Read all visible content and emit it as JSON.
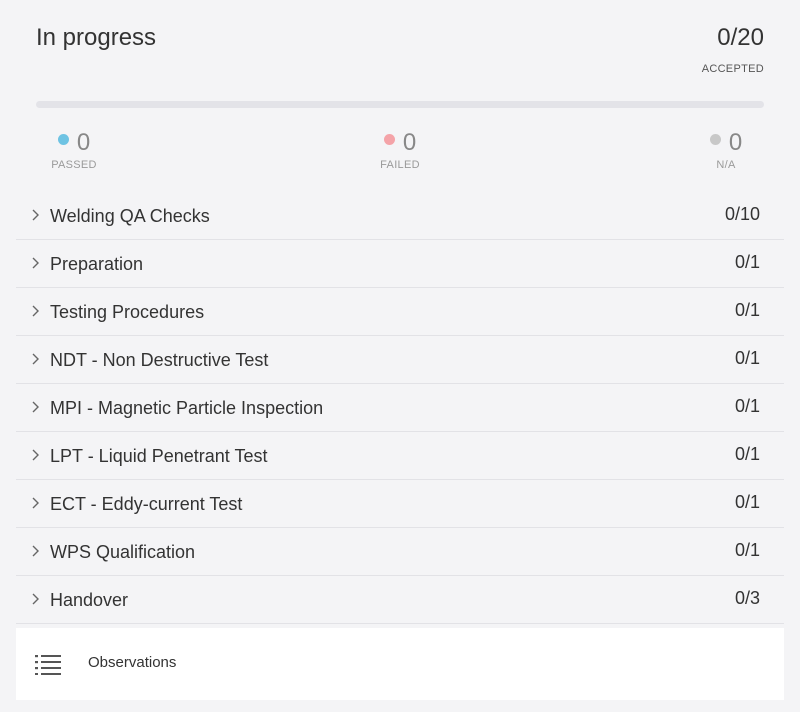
{
  "status": {
    "title": "In progress",
    "accepted_count": "0/20",
    "accepted_label": "ACCEPTED",
    "progress_fraction": 0
  },
  "stats": {
    "passed": {
      "value": "0",
      "label": "PASSED",
      "color": "#6ec3e3"
    },
    "failed": {
      "value": "0",
      "label": "FAILED",
      "color": "#f4a3a8"
    },
    "na": {
      "value": "0",
      "label": "N/A",
      "color": "#c8c8c8"
    }
  },
  "sections": [
    {
      "name": "Welding QA Checks",
      "count": "0/10"
    },
    {
      "name": "Preparation",
      "count": "0/1"
    },
    {
      "name": "Testing Procedures",
      "count": "0/1"
    },
    {
      "name": "NDT - Non Destructive Test",
      "count": "0/1"
    },
    {
      "name": "MPI - Magnetic Particle Inspection",
      "count": "0/1"
    },
    {
      "name": "LPT - Liquid Penetrant Test",
      "count": "0/1"
    },
    {
      "name": "ECT - Eddy-current Test",
      "count": "0/1"
    },
    {
      "name": "WPS Qualification",
      "count": "0/1"
    },
    {
      "name": "Handover",
      "count": "0/3"
    }
  ],
  "observations": {
    "label": "Observations",
    "icon": "list-icon"
  }
}
